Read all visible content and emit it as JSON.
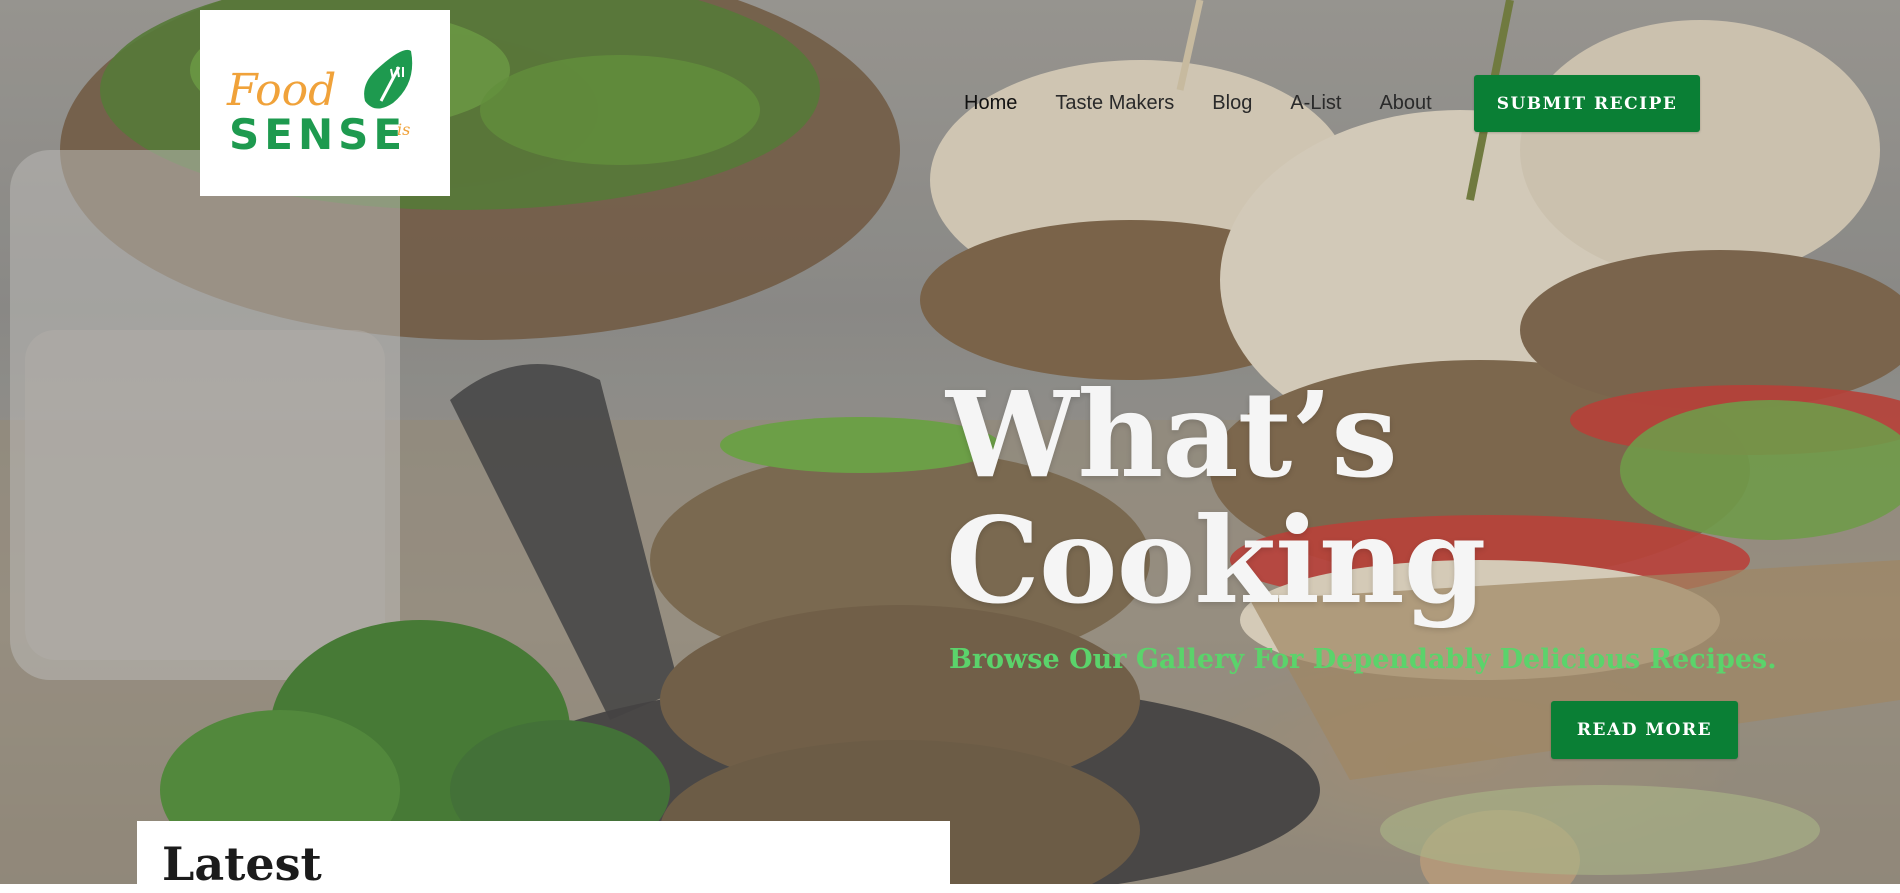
{
  "brand": {
    "logo_word_top": "Food",
    "logo_word_mid": "is",
    "logo_word_bottom": "SENSE",
    "logo_green": "#1e9a4f",
    "logo_orange": "#f0a23a"
  },
  "nav": {
    "items": [
      {
        "label": "Home",
        "active": true
      },
      {
        "label": "Taste Makers",
        "active": false
      },
      {
        "label": "Blog",
        "active": false
      },
      {
        "label": "A-List",
        "active": false
      },
      {
        "label": "About",
        "active": false
      }
    ],
    "submit_label": "SUBMIT RECIPE"
  },
  "hero": {
    "title_line1": "What’s",
    "title_line2": "Cooking",
    "subtitle": "Browse Our Gallery For Dependably Delicious Recipes.",
    "cta_label": "READ MORE"
  },
  "latest": {
    "heading": "Latest"
  },
  "colors": {
    "accent_green": "#0a7f35",
    "subtitle_green": "#5bd36b",
    "title_white": "#f5f5f5"
  }
}
